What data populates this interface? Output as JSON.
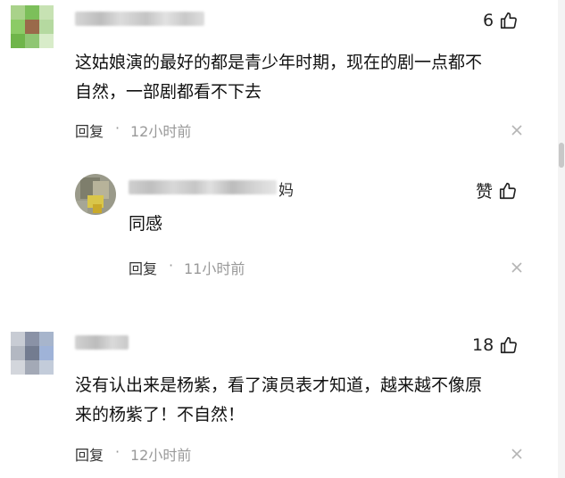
{
  "comments": [
    {
      "likes": "6",
      "text_line1": "这姑娘演的最好的都是青少年时期，现在的剧一点都不",
      "text_line2": "自然，一部剧都看不下去",
      "reply_label": "回复",
      "dot": "·",
      "time": "12小时前"
    },
    {
      "name_suffix": "妈",
      "likes_label": "赞",
      "text_line1": "同感",
      "reply_label": "回复",
      "dot": "·",
      "time": "11小时前"
    },
    {
      "likes": "18",
      "text_line1": "没有认出来是杨紫，看了演员表才知道，越来越不像原",
      "text_line2": "来的杨紫了！不自然！",
      "reply_label": "回复",
      "dot": "·",
      "time": "12小时前"
    }
  ],
  "icons": {
    "like": "thumbs-up-icon",
    "close": "close-icon"
  },
  "colors": {
    "time": "#999999",
    "text": "#111111"
  }
}
